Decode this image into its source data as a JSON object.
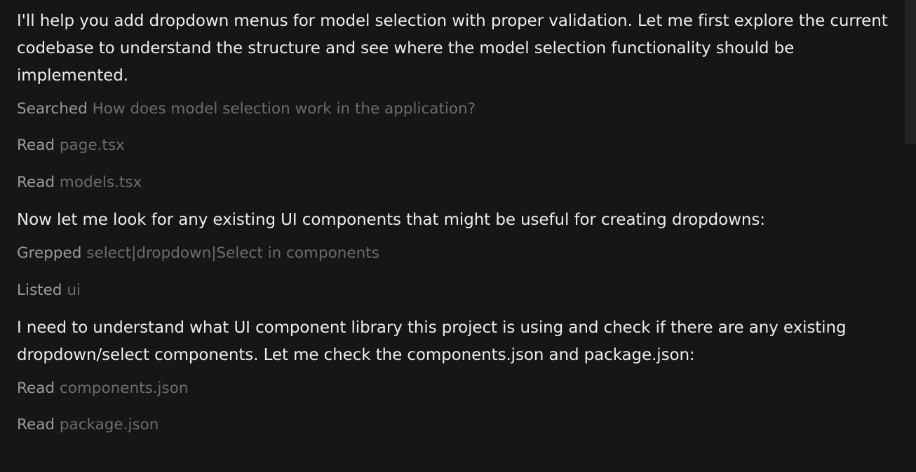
{
  "messages": [
    {
      "type": "text",
      "text": "I'll help you add dropdown menus for model selection with proper validation. Let me first explore the current codebase to understand the structure and see where the model selection functionality should be implemented."
    },
    {
      "type": "tool",
      "verb": "Searched",
      "arg": "How does model selection work in the application?"
    },
    {
      "type": "tool",
      "verb": "Read",
      "arg": "page.tsx"
    },
    {
      "type": "tool",
      "verb": "Read",
      "arg": "models.tsx"
    },
    {
      "type": "text",
      "text": "Now let me look for any existing UI components that might be useful for creating dropdowns:"
    },
    {
      "type": "tool",
      "verb": "Grepped",
      "arg": "select|dropdown|Select in components"
    },
    {
      "type": "tool",
      "verb": "Listed",
      "arg": "ui"
    },
    {
      "type": "text",
      "text": "I need to understand what UI component library this project is using and check if there are any existing dropdown/select components. Let me check the components.json and package.json:"
    },
    {
      "type": "tool",
      "verb": "Read",
      "arg": "components.json"
    },
    {
      "type": "tool",
      "verb": "Read",
      "arg": "package.json"
    }
  ]
}
